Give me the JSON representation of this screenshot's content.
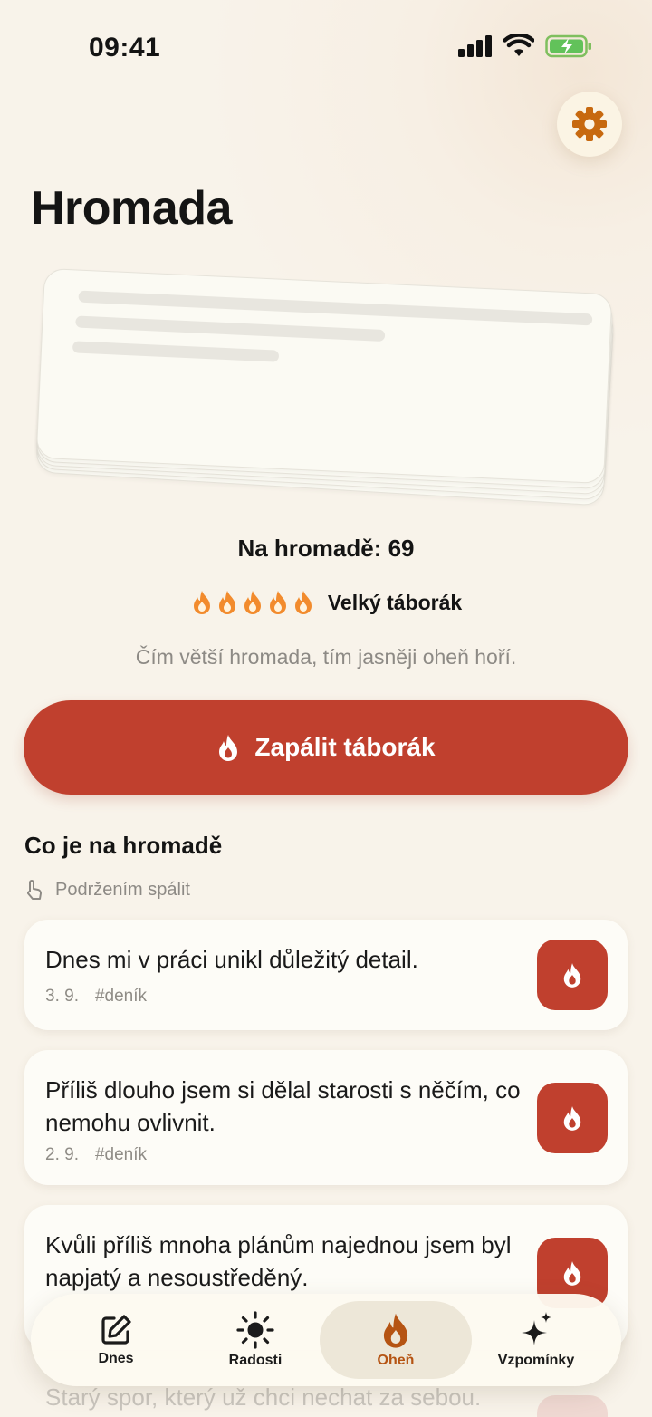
{
  "status_bar": {
    "time": "09:41"
  },
  "page": {
    "title": "Hromada"
  },
  "pile": {
    "count_text": "Na hromadě: 69",
    "fire_level_label": "Velký táborák",
    "fire_level_flames": 5,
    "hint": "Čím větší hromada, tím jasněji oheň hoří."
  },
  "actions": {
    "ignite_label": "Zapálit táborák"
  },
  "section": {
    "title": "Co je na hromadě",
    "subhint": "Podržením spálit"
  },
  "entries": [
    {
      "text": "Dnes mi v práci unikl důležitý detail.",
      "date": "3. 9.",
      "tag": "#deník"
    },
    {
      "text": "Příliš dlouho jsem si dělal starosti s něčím, co nemohu ovlivnit.",
      "date": "2. 9.",
      "tag": "#deník"
    },
    {
      "text": "Kvůli příliš mnoha plánům najednou jsem byl napjatý a nesoustředěný.",
      "date": "",
      "tag": ""
    },
    {
      "text": "Starý spor, který už chci nechat za sebou."
    }
  ],
  "tabs": [
    {
      "label": "Dnes",
      "icon": "edit-icon",
      "active": false
    },
    {
      "label": "Radosti",
      "icon": "sun-icon",
      "active": false
    },
    {
      "label": "Oheň",
      "icon": "flame-icon",
      "active": true
    },
    {
      "label": "Vzpomínky",
      "icon": "sparkles-icon",
      "active": false
    }
  ],
  "colors": {
    "accent": "#c0402e",
    "active_tab": "#b55413",
    "settings_icon": "#c7690f",
    "flame_orange": "#f28b2d",
    "background": "#f8f3ea"
  }
}
